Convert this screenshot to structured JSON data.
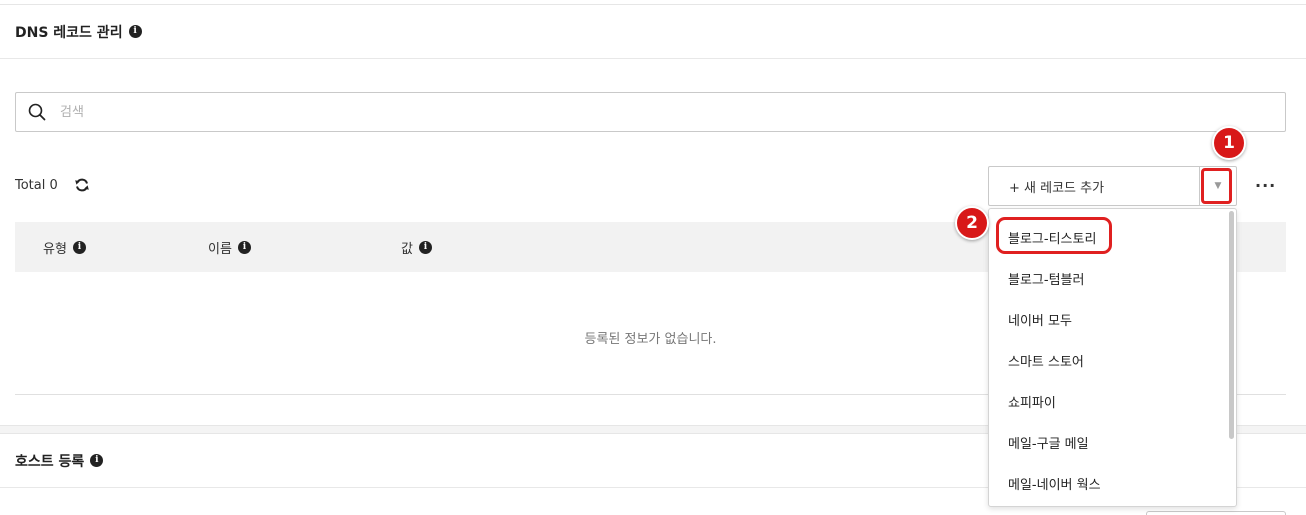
{
  "dns_section": {
    "title": "DNS 레코드 관리",
    "info_icon": "info-icon"
  },
  "search": {
    "icon": "search-icon",
    "placeholder": "검색",
    "value": ""
  },
  "toolbar": {
    "total_label": "Total 0",
    "refresh_icon": "refresh-icon",
    "add_record_label": "+ 새 레코드 추가",
    "dropdown_toggle_glyph": "▼",
    "more_label": "···"
  },
  "table": {
    "columns": [
      {
        "label": "유형"
      },
      {
        "label": "이름"
      },
      {
        "label": "값"
      }
    ],
    "empty_message": "등록된 정보가 없습니다."
  },
  "dropdown": {
    "items": [
      {
        "label": "블로그-티스토리"
      },
      {
        "label": "블로그-텀블러"
      },
      {
        "label": "네이버 모두"
      },
      {
        "label": "스마트 스토어"
      },
      {
        "label": "쇼피파이"
      },
      {
        "label": "메일-구글 메일"
      },
      {
        "label": "메일-네이버 웍스"
      }
    ]
  },
  "callouts": {
    "step1": "1",
    "step2": "2",
    "color": "#d81818"
  },
  "host_section": {
    "title": "호스트 등록",
    "info_icon": "info-icon"
  }
}
